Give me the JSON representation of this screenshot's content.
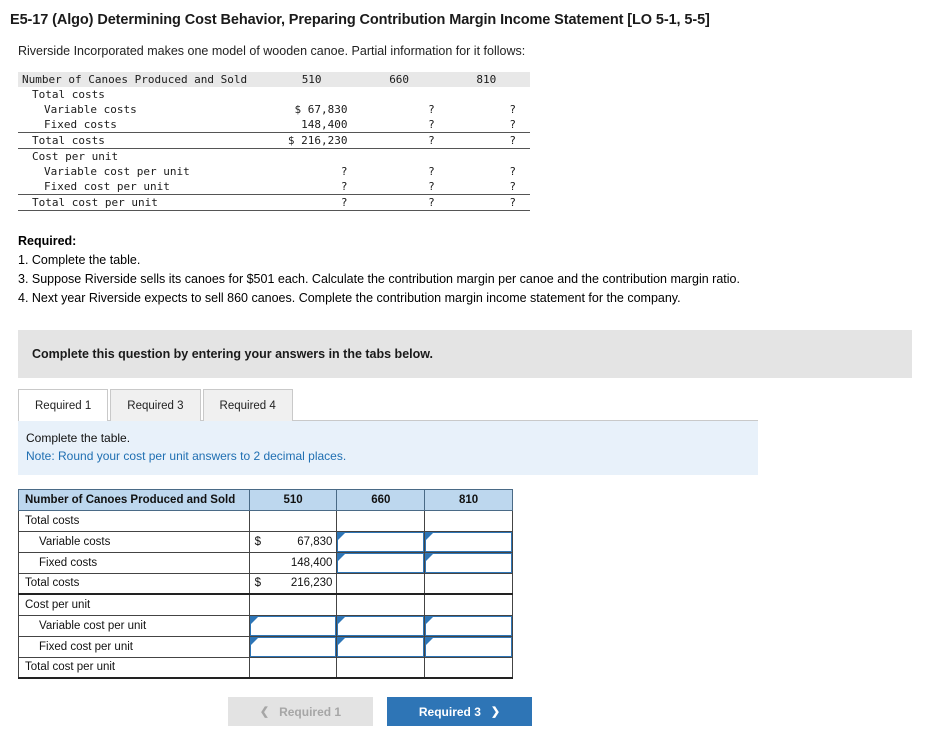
{
  "title": "E5-17 (Algo) Determining Cost Behavior, Preparing Contribution Margin Income Statement [LO 5-1, 5-5]",
  "intro": "Riverside Incorporated makes one model of wooden canoe. Partial information for it follows:",
  "top_table": {
    "header": {
      "label": "Number of Canoes Produced and Sold",
      "c1": "510",
      "c2": "660",
      "c3": "810"
    },
    "rows": [
      {
        "label": "Total costs",
        "indent": 1,
        "c1": "",
        "c2": "",
        "c3": ""
      },
      {
        "label": "Variable costs",
        "indent": 2,
        "c1": "$ 67,830",
        "c2": "?",
        "c3": "?"
      },
      {
        "label": "Fixed costs",
        "indent": 2,
        "c1": "148,400",
        "c2": "?",
        "c3": "?"
      },
      {
        "label": "Total costs",
        "indent": 1,
        "c1": "$ 216,230",
        "c2": "?",
        "c3": "?"
      },
      {
        "label": "Cost per unit",
        "indent": 1,
        "c1": "",
        "c2": "",
        "c3": ""
      },
      {
        "label": "Variable cost per unit",
        "indent": 2,
        "c1": "?",
        "c2": "?",
        "c3": "?"
      },
      {
        "label": "Fixed cost per unit",
        "indent": 2,
        "c1": "?",
        "c2": "?",
        "c3": "?"
      },
      {
        "label": "Total cost per unit",
        "indent": 1,
        "c1": "?",
        "c2": "?",
        "c3": "?"
      }
    ]
  },
  "required": {
    "heading": "Required:",
    "item1": "1. Complete the table.",
    "item3": "3. Suppose Riverside sells its canoes for $501 each. Calculate the contribution margin per canoe and the contribution margin ratio.",
    "item4": "4. Next year Riverside expects to sell 860 canoes. Complete the contribution margin income statement for the company."
  },
  "banner": "Complete this question by entering your answers in the tabs below.",
  "tabs": [
    {
      "label": "Required 1",
      "active": true
    },
    {
      "label": "Required 3",
      "active": false
    },
    {
      "label": "Required 4",
      "active": false
    }
  ],
  "instruction": {
    "line1": "Complete the table.",
    "line2": "Note: Round your cost per unit answers to 2 decimal places."
  },
  "answer_grid": {
    "header": {
      "label": "Number of Canoes Produced and Sold",
      "c1": "510",
      "c2": "660",
      "c3": "810"
    },
    "rows": [
      {
        "label": "Total costs",
        "indent": false,
        "c1": {
          "type": "blank"
        },
        "c2": {
          "type": "blank"
        },
        "c3": {
          "type": "blank"
        }
      },
      {
        "label": "Variable costs",
        "indent": true,
        "c1": {
          "type": "value",
          "dollar": "$",
          "text": "67,830"
        },
        "c2": {
          "type": "input"
        },
        "c3": {
          "type": "input"
        }
      },
      {
        "label": "Fixed costs",
        "indent": true,
        "c1": {
          "type": "value",
          "dollar": "",
          "text": "148,400"
        },
        "c2": {
          "type": "input"
        },
        "c3": {
          "type": "input"
        }
      },
      {
        "label": "Total costs",
        "indent": false,
        "thick": true,
        "c1": {
          "type": "value",
          "dollar": "$",
          "text": "216,230"
        },
        "c2": {
          "type": "blank"
        },
        "c3": {
          "type": "blank"
        }
      },
      {
        "label": "Cost per unit",
        "indent": false,
        "c1": {
          "type": "blank"
        },
        "c2": {
          "type": "blank"
        },
        "c3": {
          "type": "blank"
        }
      },
      {
        "label": "Variable cost per unit",
        "indent": true,
        "c1": {
          "type": "input"
        },
        "c2": {
          "type": "input"
        },
        "c3": {
          "type": "input"
        }
      },
      {
        "label": "Fixed cost per unit",
        "indent": true,
        "c1": {
          "type": "input"
        },
        "c2": {
          "type": "input"
        },
        "c3": {
          "type": "input"
        }
      },
      {
        "label": "Total cost per unit",
        "indent": false,
        "thick": true,
        "c1": {
          "type": "blank"
        },
        "c2": {
          "type": "blank"
        },
        "c3": {
          "type": "blank"
        }
      }
    ]
  },
  "nav": {
    "prev_label": "Required 1",
    "prev_icon": "chevron-left",
    "next_label": "Required 3",
    "next_icon": "chevron-right"
  },
  "colors": {
    "accent": "#2e75b6",
    "header_fill": "#bdd7ee",
    "panel": "#e8f1fa",
    "banner": "#e4e4e4"
  }
}
